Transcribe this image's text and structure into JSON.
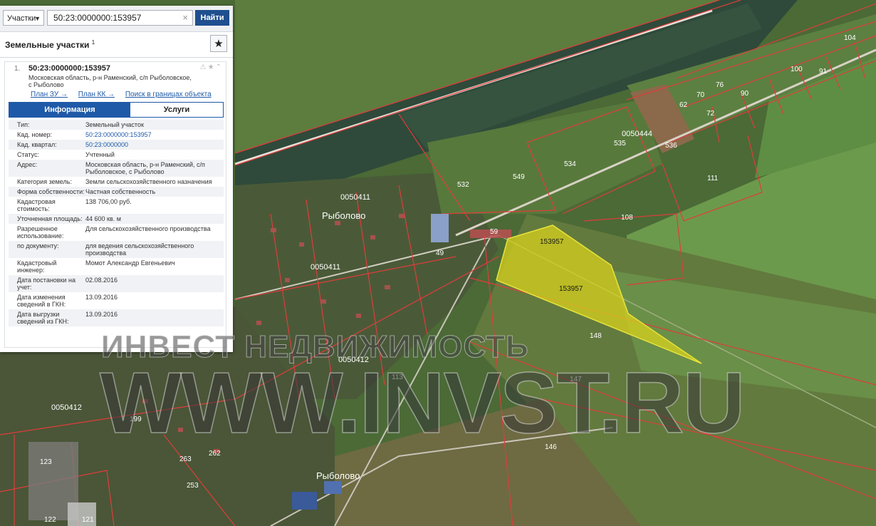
{
  "search": {
    "type_label": "Участки",
    "query": "50:23:0000000:153957",
    "button": "Найти"
  },
  "section": {
    "title": "Земельные участки",
    "count_sup": "1"
  },
  "result": {
    "index": "1.",
    "cad_number": "50:23:0000000:153957",
    "address": "Московская область, р-н Раменский, с/п Рыболовское, с Рыболово",
    "links": [
      "План ЗУ →",
      "План КК →",
      "Поиск в границах объекта →"
    ],
    "tabs": [
      "Информация",
      "Услуги"
    ],
    "attributes": [
      {
        "key": "Тип:",
        "value": "Земельный участок"
      },
      {
        "key": "Кад. номер:",
        "value": "50:23:0000000:153957"
      },
      {
        "key": "Кад. квартал:",
        "value": "50:23:0000000"
      },
      {
        "key": "Статус:",
        "value": "Учтенный"
      },
      {
        "key": "Адрес:",
        "value": "Московская область, р-н Раменский, с/п Рыболовское, с Рыболово"
      },
      {
        "key": "Категория земель:",
        "value": "Земли сельскохозяйственного назначения"
      },
      {
        "key": "Форма собственности:",
        "value": "Частная собственность"
      },
      {
        "key": "Кадастровая стоимость:",
        "value": "138 706,00 руб."
      },
      {
        "key": "Уточненная площадь:",
        "value": "44 600 кв. м"
      },
      {
        "key": "Разрешенное использование:",
        "value": "Для сельскохозяйственного производства"
      },
      {
        "key": "по документу:",
        "value": "для ведения сельскохозяйственного производства"
      },
      {
        "key": "Кадастровый инженер:",
        "value": "Момот Александр Евгеньевич"
      },
      {
        "key": "Дата постановки на учет:",
        "value": "02.08.2016"
      },
      {
        "key": "Дата изменения сведений в ГКН:",
        "value": "13.09.2016"
      },
      {
        "key": "Дата выгрузки сведений из ГКН:",
        "value": "13.09.2016"
      }
    ]
  },
  "map": {
    "selected_parcel_labels": [
      "153957",
      "153957"
    ],
    "parcel_labels": [
      "532",
      "549",
      "534",
      "535",
      "536",
      "111",
      "108",
      "148",
      "147",
      "146",
      "59",
      "49",
      "113",
      "199",
      "123",
      "122",
      "121",
      "262",
      "263",
      "253",
      "62",
      "70",
      "72",
      "90",
      "100",
      "104",
      "76",
      "91"
    ],
    "quarters": [
      "0050444",
      "0050411",
      "0050411",
      "0050412",
      "0050412"
    ],
    "places": [
      "Рыболово",
      "Рыболово"
    ],
    "colors": {
      "parcel_border": "#e03c3c",
      "selected_fill": "#d8d21e",
      "panel_accent": "#1f5aa8"
    }
  },
  "watermark": {
    "line1": "ИНВЕСТ НЕДВИЖИМОСТЬ",
    "line2": "WWW.INVST.RU"
  }
}
